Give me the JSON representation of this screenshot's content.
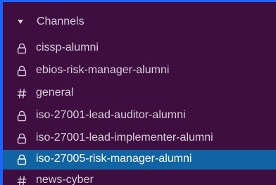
{
  "section": {
    "caret_icon": "caret-down-icon",
    "label": "Channels"
  },
  "channels": [
    {
      "name": "cissp-alumni",
      "type": "private",
      "icon": "lock-icon",
      "selected": false
    },
    {
      "name": "ebios-risk-manager-alumni",
      "type": "private",
      "icon": "lock-icon",
      "selected": false
    },
    {
      "name": "general",
      "type": "public",
      "icon": "hash-icon",
      "selected": false
    },
    {
      "name": "iso-27001-lead-auditor-alumni",
      "type": "private",
      "icon": "lock-icon",
      "selected": false
    },
    {
      "name": "iso-27001-lead-implementer-alumni",
      "type": "private",
      "icon": "lock-icon",
      "selected": false
    },
    {
      "name": "iso-27005-risk-manager-alumni",
      "type": "private",
      "icon": "lock-icon",
      "selected": true
    },
    {
      "name": "news-cyber",
      "type": "public",
      "icon": "hash-icon",
      "selected": false
    }
  ],
  "colors": {
    "sidebar_bg": "#3f0e40",
    "text": "#d9cddc",
    "selected_bg": "#1164a3",
    "selected_text": "#ffffff",
    "outer_border": "#1f63ff"
  }
}
